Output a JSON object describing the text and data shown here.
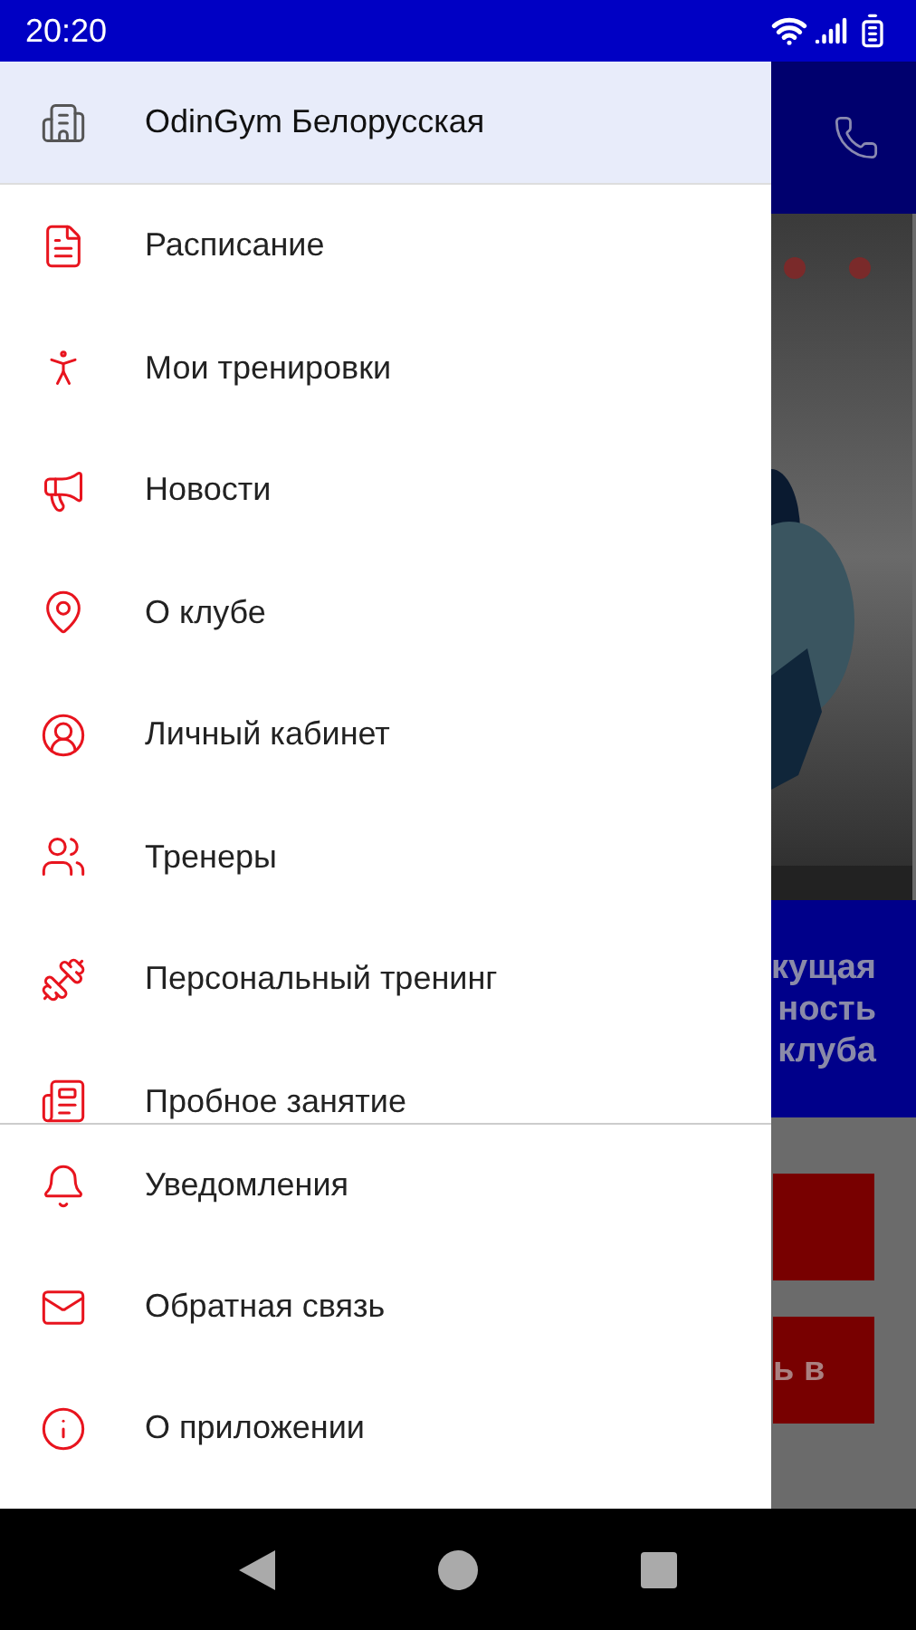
{
  "status_bar": {
    "time": "20:20"
  },
  "drawer": {
    "header": {
      "label": "OdinGym Белорусская",
      "selected": true
    },
    "items": [
      {
        "label": "Расписание",
        "selected": false
      },
      {
        "label": "Мои тренировки",
        "selected": false
      },
      {
        "label": "Новости",
        "selected": false
      },
      {
        "label": "О клубе",
        "selected": false
      },
      {
        "label": "Личный кабинет",
        "selected": false
      },
      {
        "label": "Тренеры",
        "selected": false
      },
      {
        "label": "Персональный тренинг",
        "selected": false
      },
      {
        "label": "Пробное занятие",
        "selected": false
      }
    ],
    "footer_items": [
      {
        "label": "Уведомления",
        "selected": false
      },
      {
        "label": "Обратная связь",
        "selected": false
      },
      {
        "label": "О приложении",
        "selected": false
      }
    ]
  },
  "background_app": {
    "banner_lines": [
      "кущая",
      "ность",
      "клуба"
    ],
    "buttons": [
      {
        "kind": "plain"
      },
      {
        "kind": "text",
        "label": "ь в"
      }
    ]
  }
}
